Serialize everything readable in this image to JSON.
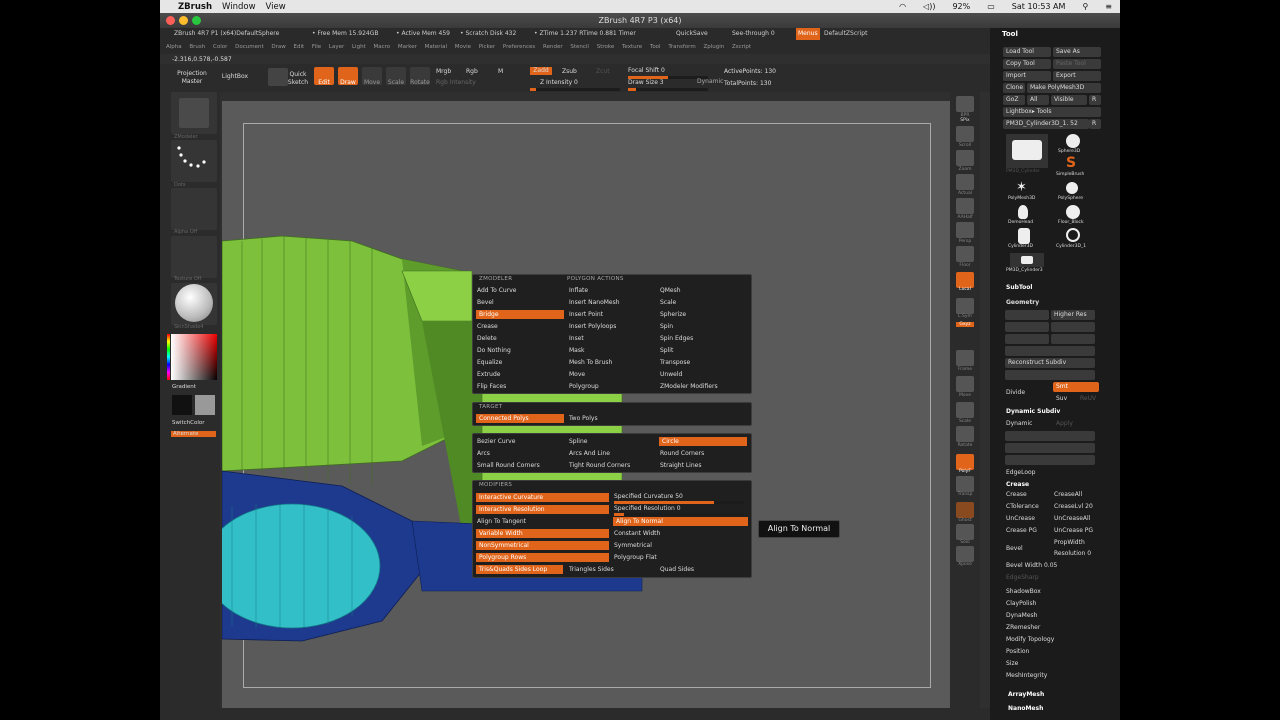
{
  "mac": {
    "app": "ZBrush",
    "menus": [
      "Window",
      "View"
    ],
    "battery": "92%",
    "clock": "Sat 10:53 AM"
  },
  "window_title": "ZBrush 4R7 P3 (x64)",
  "info": {
    "doc": "ZBrush 4R7 P1 (x64)DefaultSphere",
    "free_mem": "• Free Mem 15.924GB",
    "active_mem": "• Active Mem 459",
    "scratch": "• Scratch Disk 432",
    "ztime": "• ZTime 1.237 RTime 0.881 Timer",
    "quicksave": "QuickSave",
    "seethrough": "See-through  0",
    "menus_btn": "Menus",
    "script": "DefaultZScript"
  },
  "menubar": [
    "Alpha",
    "Brush",
    "Color",
    "Document",
    "Draw",
    "Edit",
    "File",
    "Layer",
    "Light",
    "Macro",
    "Marker",
    "Material",
    "Movie",
    "Picker",
    "Preferences",
    "Render",
    "Stencil",
    "Stroke",
    "Texture",
    "Tool",
    "Transform",
    "Zplugin",
    "Zscript"
  ],
  "coords": "-2.316,0.578,-0.587",
  "toolbar": {
    "projection": "Projection Master",
    "lightbox": "LightBox",
    "quicksketch": "Quick Sketch",
    "edit": "Edit",
    "draw": "Draw",
    "move": "Move",
    "scale": "Scale",
    "rotate": "Rotate",
    "mrgb": "Mrgb",
    "rgb": "Rgb",
    "m": "M",
    "rgb_intensity": "Rgb Intensity",
    "zadd": "Zadd",
    "zsub": "Zsub",
    "zcut": "Zcut",
    "z_intensity": "Z Intensity 0",
    "focal_shift": "Focal Shift 0",
    "draw_size": "Draw Size 3",
    "dynamic": "Dynamic",
    "active_points": "ActivePoints: 130",
    "total_points": "TotalPoints: 130"
  },
  "left_shelf": {
    "brush": "ZModeler",
    "stroke": "Dots",
    "alpha": "Alpha Off",
    "texture": "Texture Off",
    "material": "SkinShade4",
    "gradient": "Gradient",
    "switchcolor": "SwitchColor",
    "alternate": "Alternate"
  },
  "right_shelf": [
    "BPR",
    "SPix",
    "Scroll",
    "Zoom",
    "Actual",
    "AAHalf",
    "Persp",
    "Floor",
    "Local",
    "L.Sym",
    "Gxyz",
    "Frame",
    "Move",
    "Scale",
    "Rotate",
    "PolyF",
    "Transp",
    "Ghost",
    "Solo",
    "Xpose"
  ],
  "tool_palette": {
    "title": "Tool",
    "buttons": [
      [
        "Load Tool",
        "Save As"
      ],
      [
        "Copy Tool",
        "Paste Tool"
      ],
      [
        "Import",
        "Export"
      ],
      [
        "Clone",
        "Make PolyMesh3D"
      ],
      [
        "GoZ",
        "All",
        "Visible",
        "R"
      ]
    ],
    "lightbox_tools": "Lightbox▸ Tools",
    "current": "PM3D_Cylinder3D_1. 52",
    "thumbs": [
      "PM3D_Cylinder",
      "Sphere3D",
      "SimpleBrush",
      "PolyMesh3D",
      "PolySphere",
      "DemoHead",
      "Floor_Block",
      "Cylinder3D",
      "Cylinder3D_1",
      "PM3D_Cylinder3"
    ],
    "subtool": "SubTool",
    "geometry": "Geometry",
    "higher_res": "Higher Res",
    "reconstruct": "Reconstruct Subdiv",
    "divide": "Divide",
    "smt": "Smt",
    "suv": "Suv",
    "reuv": "ReUV",
    "dynamic_subdiv": "Dynamic Subdiv",
    "dynamic": "Dynamic",
    "apply": "Apply",
    "edgeloop": "EdgeLoop",
    "crease_section": "Crease",
    "crease": "Crease",
    "creaseall": "CreaseAll",
    "ctolerance": "CTolerance",
    "creaselvl": "CreaseLvl 20",
    "uncrease": "UnCrease",
    "uncreaseall": "UnCreaseAll",
    "creasepg": "Crease PG",
    "uncreasepg": "UnCrease PG",
    "bevel": "Bevel",
    "propwidth": "PropWidth",
    "resolution": "Resolution 0",
    "bevel_width": "Bevel Width 0.05",
    "edgesharp": "EdgeSharp",
    "sections": [
      "ShadowBox",
      "ClayPolish",
      "DynaMesh",
      "ZRemesher",
      "Modify Topology",
      "Position",
      "Size",
      "MeshIntegrity"
    ],
    "arraymesh": "ArrayMesh",
    "nanomesh": "NanoMesh"
  },
  "popup": {
    "zmodeler": "ZMODELER",
    "polygon_actions": "POLYGON ACTIONS",
    "col1": [
      "Add To Curve",
      "Bevel",
      "Bridge",
      "Crease",
      "Delete",
      "Do Nothing",
      "Equalize",
      "Extrude",
      "Flip Faces"
    ],
    "col2": [
      "Inflate",
      "Insert NanoMesh",
      "Insert Point",
      "Insert Polyloops",
      "Inset",
      "Mask",
      "Mesh To Brush",
      "Move",
      "Polygroup"
    ],
    "col3": [
      "QMesh",
      "Scale",
      "Spherize",
      "Spin",
      "Spin Edges",
      "Split",
      "Transpose",
      "Unweld",
      "ZModeler Modifiers"
    ],
    "target": "TARGET",
    "target_items": [
      "Connected Polys",
      "Two Polys"
    ],
    "curve_items": [
      "Bezier Curve",
      "Spline",
      "Circle",
      "Arcs",
      "Arcs And Line",
      "Round Corners",
      "Small Round Corners",
      "Tight Round Corners",
      "Straight Lines"
    ],
    "modifiers": "MODIFIERS",
    "mod_left": [
      "Interactive Curvature",
      "Interactive Resolution",
      "Align To Tangent",
      "Variable Width",
      "NonSymmetrical",
      "Polygroup Rows",
      "Tris&Quads Sides Loop"
    ],
    "mod_right": [
      "Specified Curvature 50",
      "Specified Resolution 0",
      "Align To Normal",
      "Constant Width",
      "Symmetrical",
      "Polygroup Flat",
      "Triangles Sides",
      "Quad Sides"
    ]
  },
  "tooltip": "Align To Normal",
  "colors": {
    "accent": "#e0651b",
    "green": "#7cc03c",
    "blue": "#1e3a8f",
    "cyan": "#33bfc8"
  }
}
